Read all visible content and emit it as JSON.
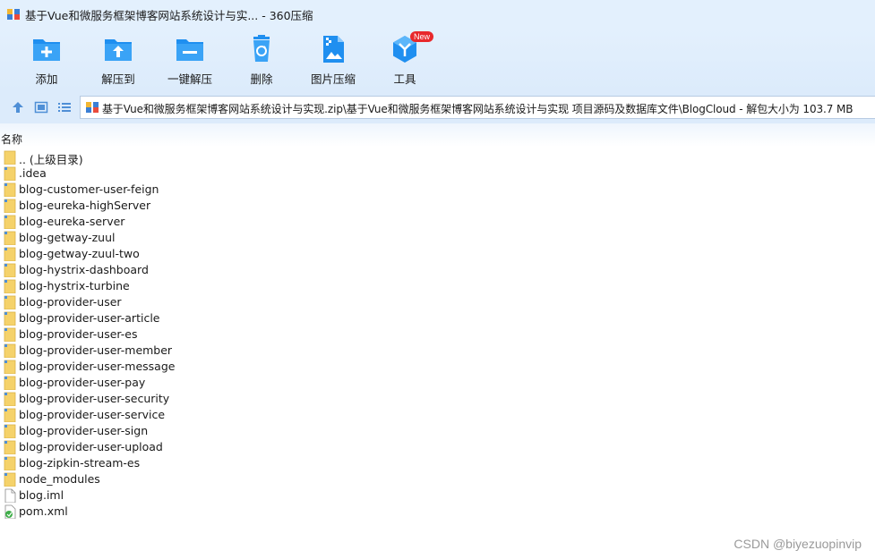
{
  "window": {
    "title": "基于Vue和微服务框架博客网站系统设计与实... - 360压缩"
  },
  "toolbar": {
    "items": [
      {
        "label": "添加",
        "icon": "add-folder-icon"
      },
      {
        "label": "解压到",
        "icon": "extract-to-icon"
      },
      {
        "label": "一键解压",
        "icon": "one-click-extract-icon"
      },
      {
        "label": "删除",
        "icon": "recycle-delete-icon"
      },
      {
        "label": "图片压缩",
        "icon": "image-compress-icon"
      },
      {
        "label": "工具",
        "icon": "tools-icon",
        "badge": "New"
      }
    ]
  },
  "navbar": {
    "address": "基于Vue和微服务框架博客网站系统设计与实现.zip\\基于Vue和微服务框架博客网站系统设计与实现 项目源码及数据库文件\\BlogCloud - 解包大小为 103.7 MB"
  },
  "file_list": {
    "column_name": "名称",
    "rows": [
      {
        "name": ".. (上级目录)",
        "type": "parent"
      },
      {
        "name": ".idea",
        "type": "folder"
      },
      {
        "name": "blog-customer-user-feign",
        "type": "folder"
      },
      {
        "name": "blog-eureka-highServer",
        "type": "folder"
      },
      {
        "name": "blog-eureka-server",
        "type": "folder"
      },
      {
        "name": "blog-getway-zuul",
        "type": "folder"
      },
      {
        "name": "blog-getway-zuul-two",
        "type": "folder"
      },
      {
        "name": "blog-hystrix-dashboard",
        "type": "folder"
      },
      {
        "name": "blog-hystrix-turbine",
        "type": "folder"
      },
      {
        "name": "blog-provider-user",
        "type": "folder"
      },
      {
        "name": "blog-provider-user-article",
        "type": "folder"
      },
      {
        "name": "blog-provider-user-es",
        "type": "folder"
      },
      {
        "name": "blog-provider-user-member",
        "type": "folder"
      },
      {
        "name": "blog-provider-user-message",
        "type": "folder"
      },
      {
        "name": "blog-provider-user-pay",
        "type": "folder"
      },
      {
        "name": "blog-provider-user-security",
        "type": "folder"
      },
      {
        "name": "blog-provider-user-service",
        "type": "folder"
      },
      {
        "name": "blog-provider-user-sign",
        "type": "folder"
      },
      {
        "name": "blog-provider-user-upload",
        "type": "folder"
      },
      {
        "name": "blog-zipkin-stream-es",
        "type": "folder"
      },
      {
        "name": "node_modules",
        "type": "folder"
      },
      {
        "name": "blog.iml",
        "type": "file"
      },
      {
        "name": "pom.xml",
        "type": "xml"
      }
    ]
  },
  "watermark": "CSDN @biyezuopinvip",
  "colors": {
    "toolbar_bg": "#dcebfb",
    "icon_blue": "#1f8ff0",
    "folder_yellow": "#f5d26a",
    "badge_red": "#e8292c"
  }
}
